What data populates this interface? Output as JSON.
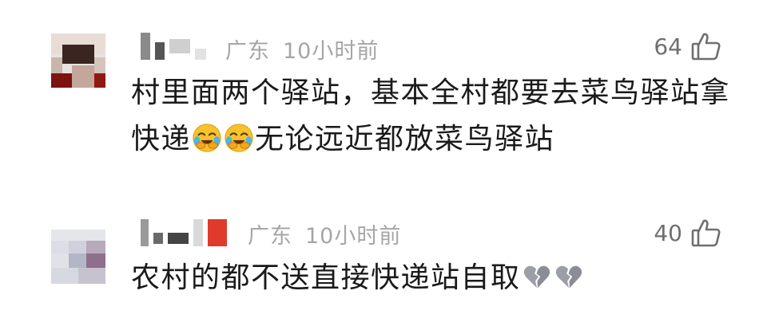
{
  "comments": [
    {
      "region": "广东",
      "time": "10小时前",
      "likes": "64",
      "text_line1": "村里面两个驿站，基本全村都要去菜鸟驿站拿",
      "text_line2a": "快递",
      "text_line2b": "无论远近都放菜鸟驿站",
      "emojis": [
        "face-with-tears-of-joy-covering-face-icon",
        "face-with-tears-of-joy-covering-face-icon"
      ]
    },
    {
      "region": "广东",
      "time": "10小时前",
      "likes": "40",
      "text": "农村的都不送直接快递站自取",
      "emojis": [
        "broken-heart-icon",
        "broken-heart-icon"
      ]
    }
  ],
  "icons": {
    "like": "thumbs-up-outline-icon"
  },
  "colors": {
    "meta_text": "#a6a6a6",
    "body_text": "#1a1a1a",
    "like_icon": "#6f6f6f"
  }
}
